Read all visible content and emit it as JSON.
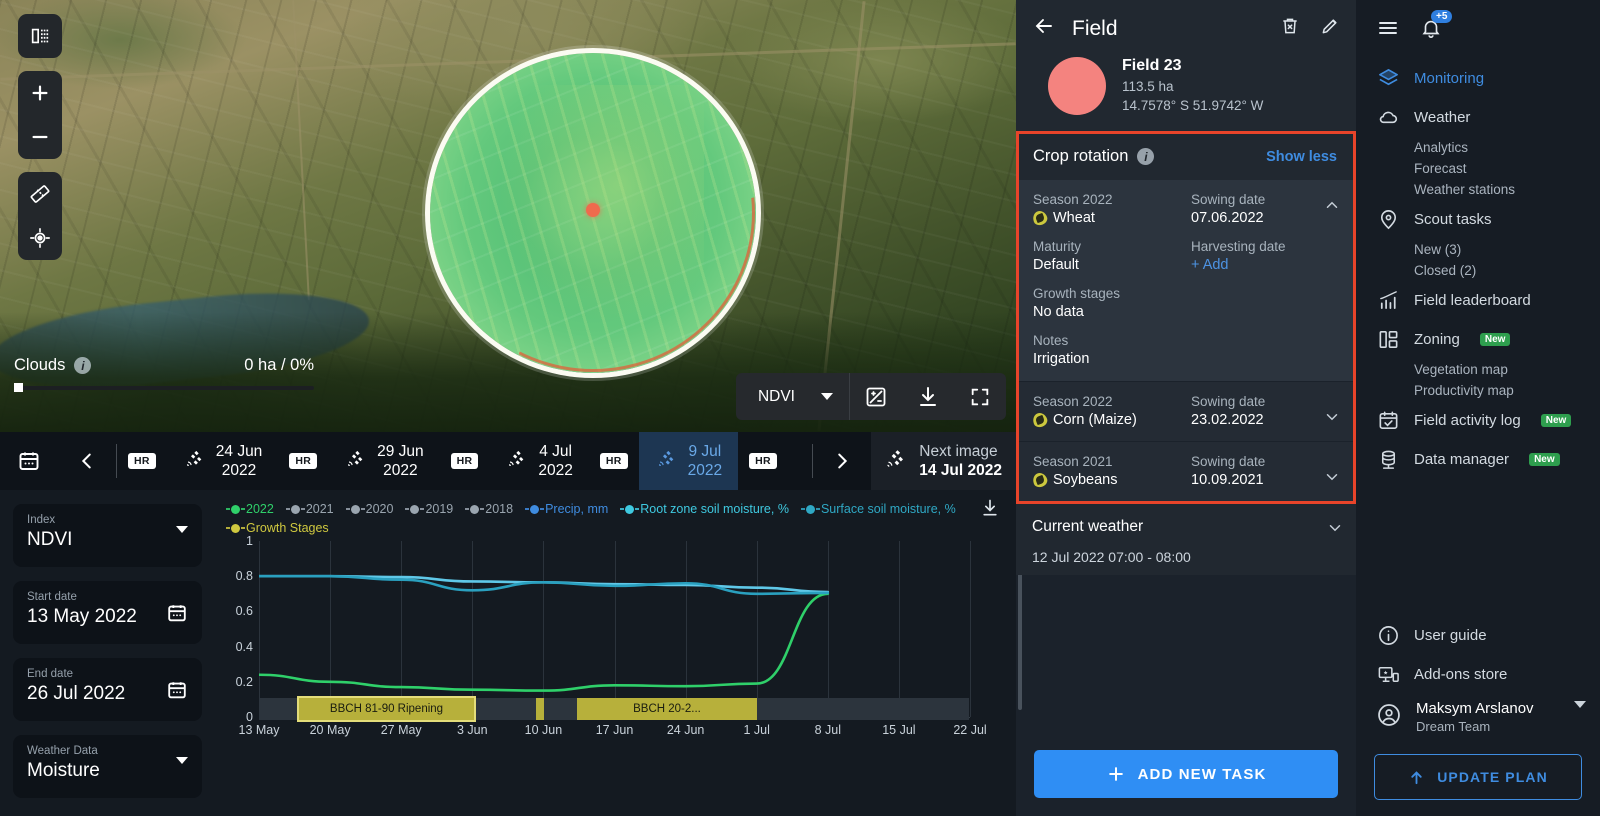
{
  "map": {
    "tools": [
      {
        "name": "split-view-icon"
      },
      {
        "name": "zoom-in-icon"
      },
      {
        "name": "zoom-out-icon"
      },
      {
        "name": "ruler-icon"
      },
      {
        "name": "locate-icon"
      }
    ],
    "clouds_label": "Clouds",
    "clouds_value": "0 ha / 0%",
    "index_selected": "NDVI",
    "controls": [
      "contrast-icon",
      "download-icon",
      "fullscreen-icon"
    ]
  },
  "timeline": {
    "hr_chip": "HR",
    "dates": [
      {
        "day": "24 Jun",
        "year": "2022",
        "active": false
      },
      {
        "day": "29 Jun",
        "year": "2022",
        "active": false
      },
      {
        "day": "4 Jul",
        "year": "2022",
        "active": false
      },
      {
        "day": "9 Jul",
        "year": "2022",
        "active": true
      }
    ],
    "next_label": "Next image",
    "next_date": "14 Jul 2022"
  },
  "analytics": {
    "fields": [
      {
        "label": "Index",
        "value": "NDVI",
        "control": "dropdown"
      },
      {
        "label": "Start date",
        "value": "13 May 2022",
        "control": "calendar"
      },
      {
        "label": "End date",
        "value": "26 Jul 2022",
        "control": "calendar"
      },
      {
        "label": "Weather Data",
        "value": "Moisture",
        "control": "dropdown"
      }
    ],
    "download_icon": "download-icon"
  },
  "chart_data": {
    "type": "line",
    "title": "",
    "xlabel": "",
    "ylabel": "",
    "ylim": [
      0,
      1
    ],
    "yticks": [
      0,
      0.2,
      0.4,
      0.6,
      0.8,
      1
    ],
    "grid": true,
    "legend_position": "top",
    "x": [
      "13 May",
      "20 May",
      "27 May",
      "3 Jun",
      "10 Jun",
      "17 Jun",
      "24 Jun",
      "1 Jul",
      "8 Jul",
      "15 Jul",
      "22 Jul"
    ],
    "legend": [
      {
        "label": "2022",
        "color": "#2fd06a"
      },
      {
        "label": "2021",
        "color": "#9aa5af"
      },
      {
        "label": "2020",
        "color": "#9aa5af"
      },
      {
        "label": "2019",
        "color": "#9aa5af"
      },
      {
        "label": "2018",
        "color": "#9aa5af"
      },
      {
        "label": "Precip, mm",
        "color": "#3f8ce0"
      },
      {
        "label": "Root zone soil moisture, %",
        "color": "#3fc9e0"
      },
      {
        "label": "Surface soil moisture, %",
        "color": "#2fa8c4"
      },
      {
        "label": "Growth Stages",
        "color": "#cfc83f"
      }
    ],
    "series": [
      {
        "name": "2022",
        "color": "#2fd06a",
        "values": [
          0.24,
          0.2,
          0.17,
          0.155,
          0.15,
          0.18,
          0.175,
          0.19,
          0.7,
          null,
          null
        ]
      },
      {
        "name": "Root zone soil moisture, %",
        "color": "#5fc8e8",
        "values": [
          0.8,
          0.8,
          0.795,
          0.77,
          0.765,
          0.755,
          0.75,
          0.735,
          0.71,
          null,
          null
        ]
      },
      {
        "name": "Surface soil moisture, %",
        "color": "#2aa0bf",
        "values": [
          0.8,
          0.8,
          0.78,
          0.72,
          0.765,
          0.745,
          0.76,
          0.7,
          0.705,
          null,
          null
        ]
      }
    ],
    "growth_stages": [
      {
        "label": "BBCH 81-90 Ripening",
        "start": "13 May",
        "end": "25 May",
        "color": "#b7b03b"
      },
      {
        "label": "BBCH 20-2...",
        "start": "12 Jun",
        "end": "2 Jul",
        "color": "#b7b03b"
      }
    ]
  },
  "panel": {
    "back_icon": "back-arrow-icon",
    "title": "Field",
    "delete_icon": "delete-icon",
    "edit_icon": "edit-icon",
    "field_name": "Field 23",
    "field_area": "113.5 ha",
    "field_coords": "14.7578° S 51.9742° W",
    "crop_rotation": {
      "title": "Crop rotation",
      "info_icon": "info-icon",
      "toggle_label": "Show less",
      "expanded": {
        "season_label": "Season 2022",
        "crop": "Wheat",
        "sowing_label": "Sowing date",
        "sowing_date": "07.06.2022",
        "maturity_label": "Maturity",
        "maturity": "Default",
        "harvesting_label": "Harvesting date",
        "harvesting_action": "+ Add",
        "growth_label": "Growth stages",
        "growth_value": "No data",
        "notes_label": "Notes",
        "notes_value": "Irrigation"
      },
      "collapsed": [
        {
          "season_label": "Season 2022",
          "crop": "Corn (Maize)",
          "sowing_label": "Sowing date",
          "sowing_date": "23.02.2022"
        },
        {
          "season_label": "Season 2021",
          "crop": "Soybeans",
          "sowing_label": "Sowing date",
          "sowing_date": "10.09.2021"
        }
      ]
    },
    "weather": {
      "title": "Current weather",
      "subtitle": "12 Jul 2022 07:00 - 08:00"
    },
    "add_task_label": "ADD NEW TASK"
  },
  "nav": {
    "menu_icon": "hamburger-menu-icon",
    "bell_icon": "bell-icon",
    "bell_badge": "+5",
    "items": [
      {
        "label": "Monitoring",
        "icon": "layers-icon",
        "active": true,
        "badge": "",
        "subs": []
      },
      {
        "label": "Weather",
        "icon": "cloud-icon",
        "active": false,
        "badge": "",
        "subs": [
          "Analytics",
          "Forecast",
          "Weather stations"
        ]
      },
      {
        "label": "Scout tasks",
        "icon": "pin-icon",
        "active": false,
        "badge": "",
        "subs": [
          "New (3)",
          "Closed (2)"
        ]
      },
      {
        "label": "Field leaderboard",
        "icon": "bar-chart-icon",
        "active": false,
        "badge": "",
        "subs": []
      },
      {
        "label": "Zoning",
        "icon": "zoning-icon",
        "active": false,
        "badge": "New",
        "subs": [
          "Vegetation map",
          "Productivity map"
        ]
      },
      {
        "label": "Field activity log",
        "icon": "calendar-check-icon",
        "active": false,
        "badge": "New",
        "subs": []
      },
      {
        "label": "Data manager",
        "icon": "database-icon",
        "active": false,
        "badge": "New",
        "subs": []
      }
    ],
    "bottom_items": [
      {
        "label": "User guide",
        "icon": "info-circle-icon"
      },
      {
        "label": "Add-ons store",
        "icon": "store-icon"
      }
    ],
    "user_name": "Maksym Arslanov",
    "user_team": "Dream Team",
    "update_plan_label": "UPDATE PLAN"
  }
}
